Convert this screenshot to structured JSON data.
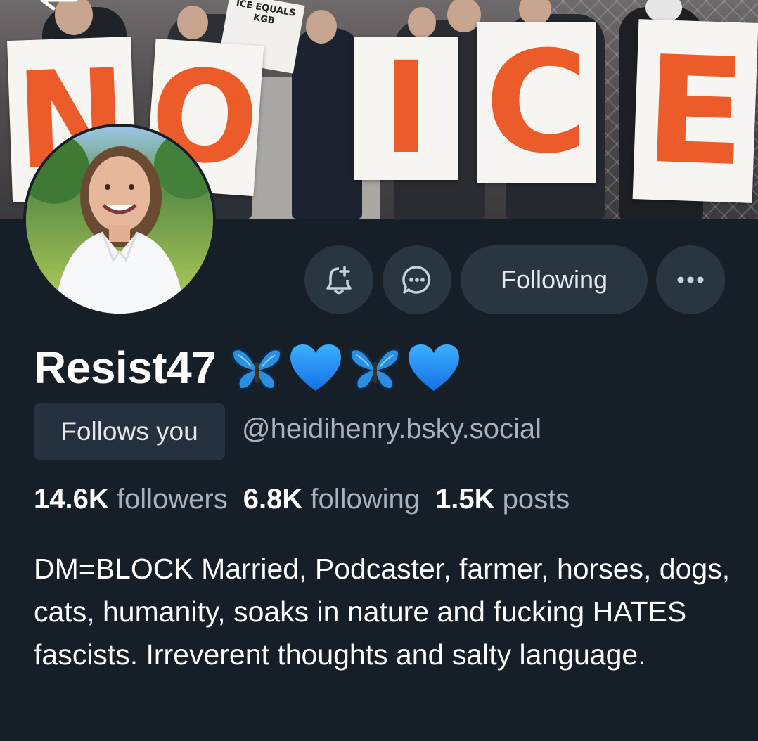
{
  "banner": {
    "signs": [
      "N",
      "O",
      "I",
      "C",
      "E"
    ],
    "small_sign": "ICE EQUALS KGB",
    "back_icon": "back-arrow-icon"
  },
  "avatar": {
    "icon": "profile-photo"
  },
  "actions": {
    "subscribe_icon": "bell-plus-icon",
    "message_icon": "chat-bubble-icon",
    "following_label": "Following",
    "more_icon": "more-dots-icon"
  },
  "profile": {
    "display_name": "Resist47",
    "name_emojis": [
      "butterfly",
      "blue-heart",
      "butterfly",
      "blue-heart"
    ],
    "follows_you_label": "Follows you",
    "handle": "@heidihenry.bsky.social"
  },
  "stats": {
    "followers_count": "14.6K",
    "followers_label": "followers",
    "following_count": "6.8K",
    "following_label": "following",
    "posts_count": "1.5K",
    "posts_label": "posts"
  },
  "bio": "DM=BLOCK Married, Podcaster, farmer, horses, dogs, cats, humanity, soaks in nature and fucking HATES fascists. Irreverent thoughts and salty language.",
  "colors": {
    "background": "#161e27",
    "button_bg": "#2a3542",
    "muted_text": "#a7b2bf",
    "sign_letter": "#ec5b2a"
  }
}
